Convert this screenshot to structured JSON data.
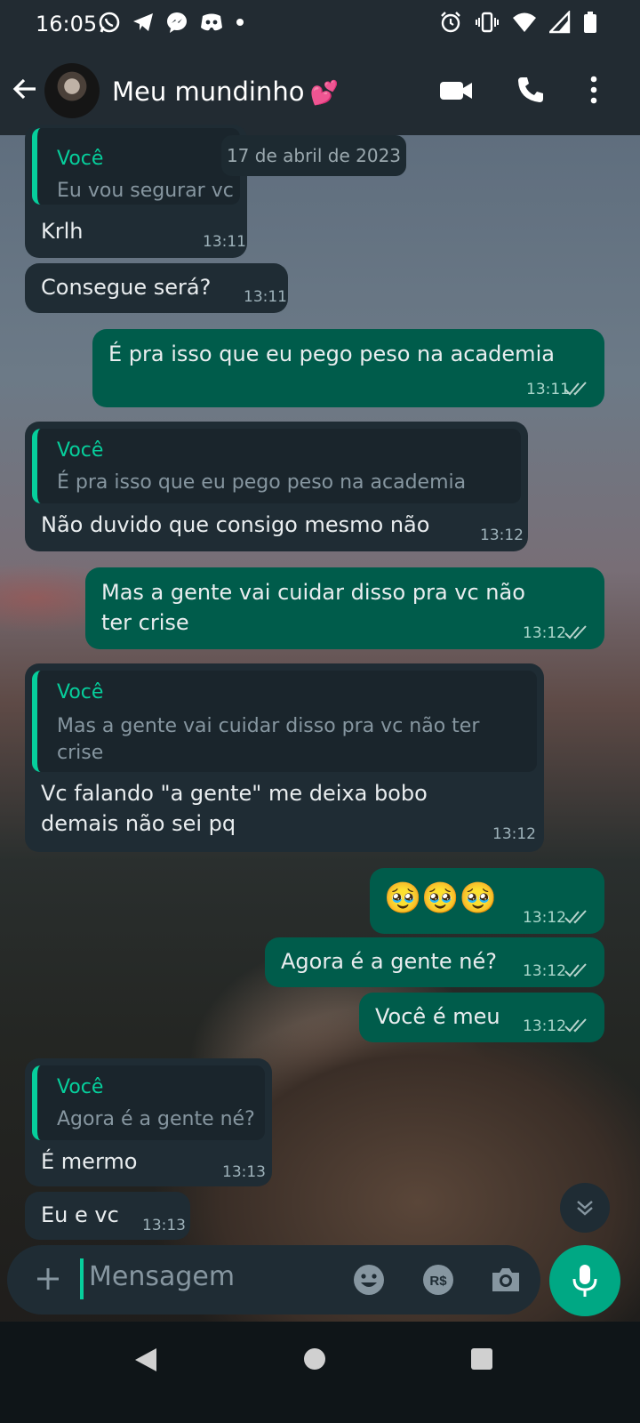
{
  "status_bar": {
    "time": "16:05",
    "left_icons": [
      "whatsapp-icon",
      "telegram-icon",
      "messenger-icon",
      "discord-icon",
      "dot-icon"
    ],
    "right_icons": [
      "alarm-icon",
      "vibrate-icon",
      "wifi-icon",
      "signal-icon",
      "battery-icon"
    ]
  },
  "header": {
    "contact_name": "Meu mundinho",
    "contact_emoji": "💕",
    "actions": [
      "video-call-icon",
      "voice-call-icon",
      "more-options-icon"
    ]
  },
  "date_chip": "17 de abril de 2023",
  "messages": [
    {
      "dir": "in",
      "quote_author": "Você",
      "quote_text": "Eu vou segurar vc",
      "text": "Krlh",
      "time": "13:11"
    },
    {
      "dir": "in",
      "text": "Consegue será?",
      "time": "13:11"
    },
    {
      "dir": "out",
      "text": "É pra isso que eu pego peso na academia",
      "time": "13:11"
    },
    {
      "dir": "in",
      "quote_author": "Você",
      "quote_text": "É pra isso que eu pego peso na academia",
      "text": "Não duvido que consigo mesmo não",
      "time": "13:12"
    },
    {
      "dir": "out",
      "text_lines": [
        "Mas a gente vai cuidar disso pra vc não",
        "ter crise"
      ],
      "time": "13:12"
    },
    {
      "dir": "in",
      "quote_author": "Você",
      "quote_lines": [
        "Mas a gente vai cuidar disso pra vc não ter",
        "crise"
      ],
      "text_lines": [
        "Vc falando \"a gente\" me deixa bobo",
        "demais não sei pq"
      ],
      "time": "13:12"
    },
    {
      "dir": "out",
      "text": "🥹🥹🥹",
      "time": "13:12"
    },
    {
      "dir": "out",
      "text": "Agora é a gente né?",
      "time": "13:12"
    },
    {
      "dir": "out",
      "text": "Você é meu",
      "time": "13:12"
    },
    {
      "dir": "in",
      "quote_author": "Você",
      "quote_text": "Agora é a gente né?",
      "text": "É mermo",
      "time": "13:13"
    },
    {
      "dir": "in",
      "text": "Eu e vc",
      "time": "13:13"
    }
  ],
  "input": {
    "placeholder": "Mensagem",
    "icons": [
      "attach-plus-icon",
      "emoji-icon",
      "payment-icon",
      "camera-icon",
      "mic-icon"
    ]
  },
  "colors": {
    "header_bg": "#222b32",
    "incoming_bubble": "#1f2c34",
    "outgoing_bubble": "#005c4b",
    "accent": "#06cf9c",
    "mic_button": "#00a884"
  }
}
